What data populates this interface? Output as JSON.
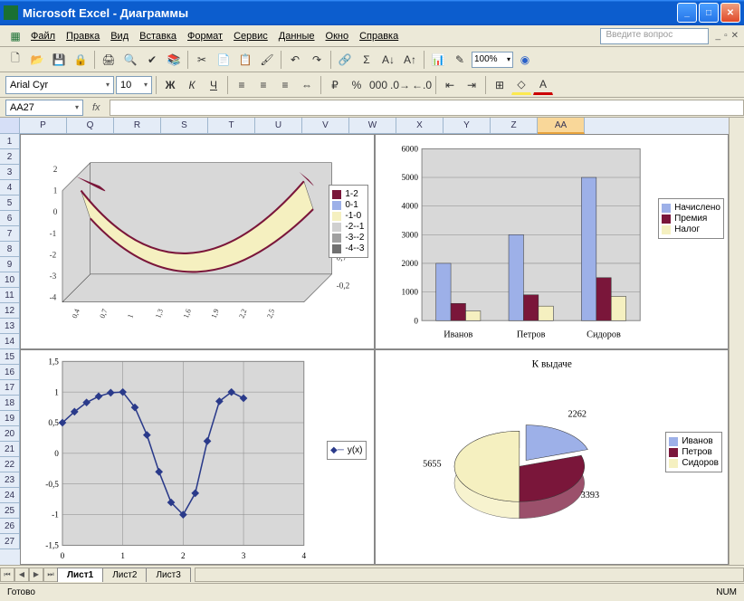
{
  "window": {
    "title": "Microsoft Excel - Диаграммы"
  },
  "menu": {
    "file": "Файл",
    "edit": "Правка",
    "view": "Вид",
    "insert": "Вставка",
    "format": "Формат",
    "service": "Сервис",
    "data": "Данные",
    "window": "Окно",
    "help": "Справка",
    "question_placeholder": "Введите вопрос"
  },
  "toolbar": {
    "zoom": "100%"
  },
  "format": {
    "font": "Arial Cyr",
    "size": "10"
  },
  "formula": {
    "cell": "AA27",
    "fx": "fx"
  },
  "columns": [
    "P",
    "Q",
    "R",
    "S",
    "T",
    "U",
    "V",
    "W",
    "X",
    "Y",
    "Z",
    "AA"
  ],
  "rows": [
    1,
    2,
    3,
    4,
    5,
    6,
    7,
    8,
    9,
    10,
    11,
    12,
    13,
    14,
    15,
    16,
    17,
    18,
    19,
    20,
    21,
    22,
    23,
    24,
    25,
    26,
    27
  ],
  "tabs": {
    "t1": "Лист1",
    "t2": "Лист2",
    "t3": "Лист3"
  },
  "status": {
    "ready": "Готово",
    "num": "NUM"
  },
  "chart_data": [
    {
      "type": "surface3d",
      "title": "",
      "x_ticks": [
        0.4,
        0.7,
        1,
        1.3,
        1.6,
        1.9,
        2.2,
        2.5
      ],
      "y_ticks": [
        -0.2,
        0.7
      ],
      "z_ticks": [
        -4,
        -3,
        -2,
        -1,
        0,
        1,
        2
      ],
      "legend": [
        "1-2",
        "0-1",
        "-1-0",
        "-2--1",
        "-3--2",
        "-4--3"
      ]
    },
    {
      "type": "bar",
      "categories": [
        "Иванов",
        "Петров",
        "Сидоров"
      ],
      "series": [
        {
          "name": "Начислено",
          "values": [
            2000,
            3000,
            5000
          ],
          "color": "#9db0e8"
        },
        {
          "name": "Премия",
          "values": [
            600,
            900,
            1500
          ],
          "color": "#7a163a"
        },
        {
          "name": "Налог",
          "values": [
            338,
            507,
            845
          ],
          "color": "#f5f0c0"
        }
      ],
      "ylim": [
        0,
        6000
      ],
      "yticks": [
        0,
        1000,
        2000,
        3000,
        4000,
        5000,
        6000
      ]
    },
    {
      "type": "line",
      "series_name": "y(x)",
      "x": [
        0,
        0.2,
        0.4,
        0.6,
        0.8,
        1.0,
        1.2,
        1.4,
        1.6,
        1.8,
        2.0,
        2.2,
        2.4,
        2.6,
        2.8,
        3.0
      ],
      "y": [
        0.5,
        0.68,
        0.83,
        0.93,
        0.99,
        1.0,
        0.75,
        0.3,
        -0.3,
        -0.8,
        -1.0,
        -0.65,
        0.2,
        0.85,
        1.0,
        0.9
      ],
      "xlim": [
        0,
        4
      ],
      "ylim": [
        -1.5,
        1.5
      ],
      "xticks": [
        0,
        1,
        2,
        3,
        4
      ],
      "yticks": [
        -1.5,
        -1,
        -0.5,
        0,
        0.5,
        1,
        1.5
      ]
    },
    {
      "type": "pie3d",
      "title": "К выдаче",
      "slices": [
        {
          "name": "Иванов",
          "value": 2262,
          "color": "#9db0e8"
        },
        {
          "name": "Петров",
          "value": 3393,
          "color": "#7a163a"
        },
        {
          "name": "Сидоров",
          "value": 5655,
          "color": "#f5f0c0"
        }
      ]
    }
  ]
}
